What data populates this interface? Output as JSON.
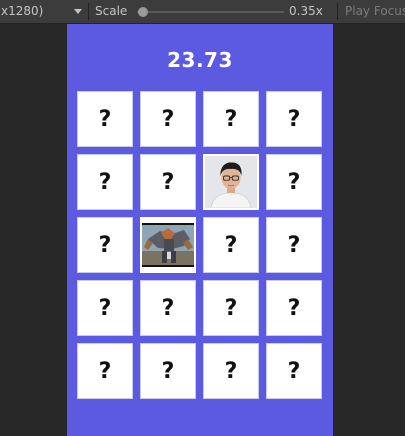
{
  "toolbar": {
    "resolution_label": "x1280)",
    "scale_label": "Scale",
    "scale_value": "0.35x",
    "play_focus_label": "Play Focus"
  },
  "game": {
    "timer": "23.73",
    "hidden_symbol": "?",
    "grid": [
      [
        "?",
        "?",
        "?",
        "?"
      ],
      [
        "?",
        "?",
        "photo-portrait",
        "?"
      ],
      [
        "?",
        "photo-robot",
        "?",
        "?"
      ],
      [
        "?",
        "?",
        "?",
        "?"
      ],
      [
        "?",
        "?",
        "?",
        "?"
      ]
    ],
    "colors": {
      "background": "#5b5ae0",
      "card": "#ffffff",
      "editor": "#282828"
    }
  }
}
